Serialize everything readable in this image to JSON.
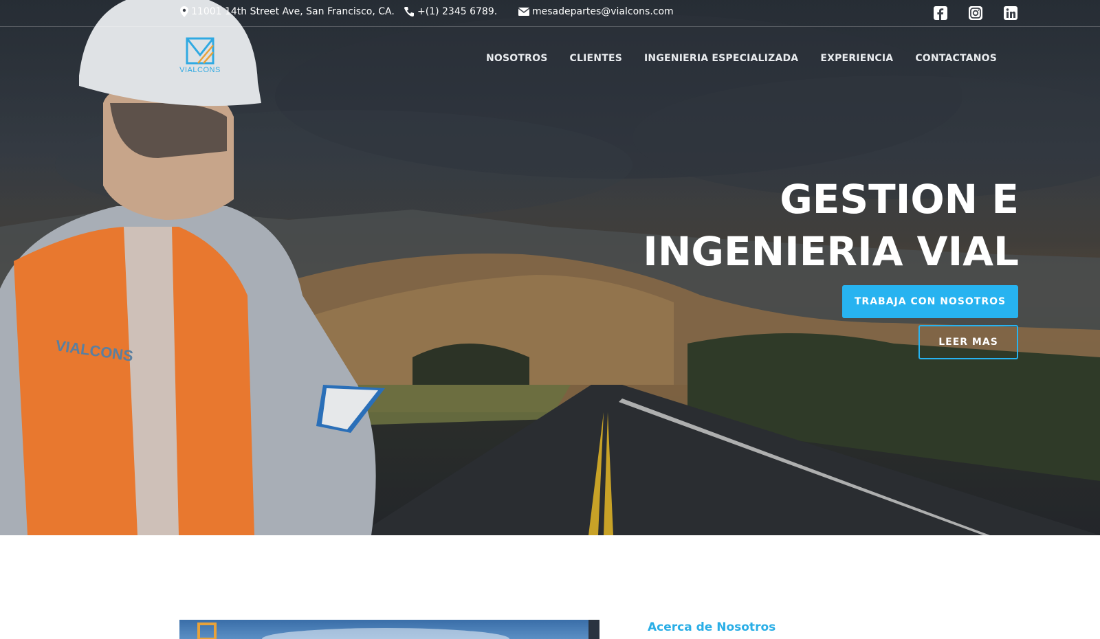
{
  "topbar": {
    "address": "11001 14th Street Ave, San Francisco, CA.",
    "phone": "+(1) 2345 6789.",
    "email": "mesadepartes@vialcons.com",
    "social": [
      "facebook-icon",
      "instagram-icon",
      "linkedin-icon"
    ]
  },
  "logo": {
    "text": "VIALCONS"
  },
  "nav": {
    "items": [
      "NOSOTROS",
      "CLIENTES",
      "INGENIERIA ESPECIALIZADA",
      "EXPERIENCIA",
      "CONTACTANOS"
    ]
  },
  "hero": {
    "title_line1": "GESTION E",
    "title_line2": "INGENIERIA VIAL",
    "primary_button": "TRABAJA CON NOSOTROS",
    "secondary_button": "LEER MAS",
    "vest_text": "VIALCONS"
  },
  "about": {
    "title": "Acerca de Nosotros"
  },
  "colors": {
    "accent": "#27b3f0",
    "vest": "#e8782f"
  }
}
